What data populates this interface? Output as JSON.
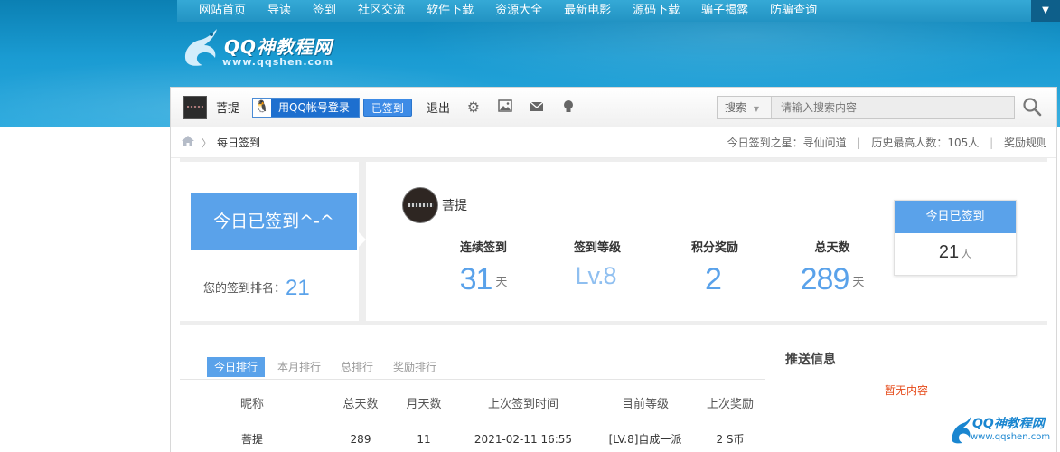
{
  "nav": {
    "items": [
      "网站首页",
      "导读",
      "签到",
      "社区交流",
      "软件下载",
      "资源大全",
      "最新电影",
      "源码下载",
      "骗子揭露",
      "防骗查询"
    ]
  },
  "logo": {
    "text": "QQ神教程网",
    "url": "www.qqshen.com"
  },
  "toolbar": {
    "username": "菩提",
    "qq_login": "用QQ帐号登录",
    "signed": "已签到",
    "logout": "退出",
    "icons": [
      "gear-icon",
      "image-icon",
      "mail-icon",
      "bulb-icon"
    ]
  },
  "search": {
    "select_label": "搜索",
    "placeholder": "请输入搜索内容"
  },
  "breadcrumb": {
    "current": "每日签到",
    "star_label": "今日签到之星：寻仙问道",
    "max_label": "历史最高人数：105人",
    "rules_label": "奖励规则"
  },
  "sign": {
    "button_label": "今日已签到^-^",
    "rank_label": "您的签到排名：",
    "rank_value": "21",
    "username": "菩提",
    "stats": [
      {
        "label": "连续签到",
        "value": "31",
        "unit": "天"
      },
      {
        "label": "签到等级",
        "value": "Lv.8",
        "unit": ""
      },
      {
        "label": "积分奖励",
        "value": "2",
        "unit": ""
      },
      {
        "label": "总天数",
        "value": "289",
        "unit": "天"
      }
    ],
    "today": {
      "label": "今日已签到",
      "value": "21",
      "unit": "人"
    }
  },
  "tabs": [
    {
      "label": "今日排行",
      "active": true
    },
    {
      "label": "本月排行",
      "active": false
    },
    {
      "label": "总排行",
      "active": false
    },
    {
      "label": "奖励排行",
      "active": false
    }
  ],
  "table": {
    "headers": [
      "昵称",
      "总天数",
      "月天数",
      "上次签到时间",
      "目前等级",
      "上次奖励"
    ],
    "rows": [
      [
        "菩提",
        "289",
        "11",
        "2021-02-11 16:55",
        "[LV.8]自成一派",
        "2 S币"
      ]
    ]
  },
  "push": {
    "title": "推送信息",
    "empty": "暂无内容"
  },
  "watermark": {
    "text": "QQ神教程网",
    "url": "www.qqshen.com"
  },
  "colors": {
    "accent": "#5aa2ea",
    "banner": "#1a9bd2",
    "empty_text": "#e64a19"
  }
}
